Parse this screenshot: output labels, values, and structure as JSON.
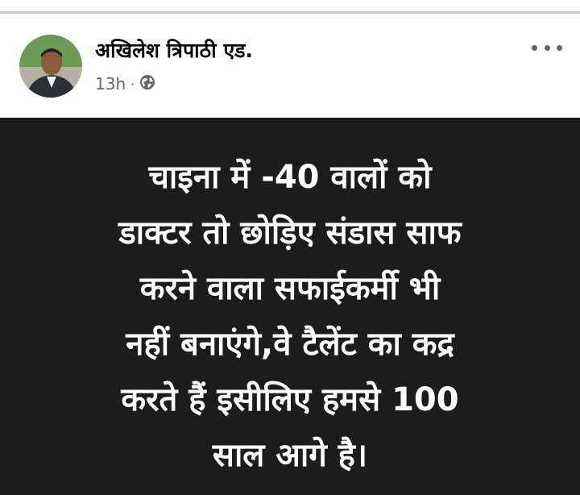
{
  "post": {
    "author": "अखिलेश त्रिपाठी एड.",
    "time": "13h",
    "separator": "·",
    "privacy_icon": "globe-icon",
    "more_icon": "more-options-icon",
    "lines": [
      "चाइना में -40 वालों को",
      "डाक्टर तो छोड़िए संडास साफ",
      "करने वाला सफाईकर्मी भी",
      "नहीं बनाएंगे,वे टैलेंट का कद्र",
      "करते हैं इसीलिए हमसे 100",
      "साल आगे है।"
    ],
    "card_background": "#1c1c1c",
    "text_color": "#ffffff"
  }
}
